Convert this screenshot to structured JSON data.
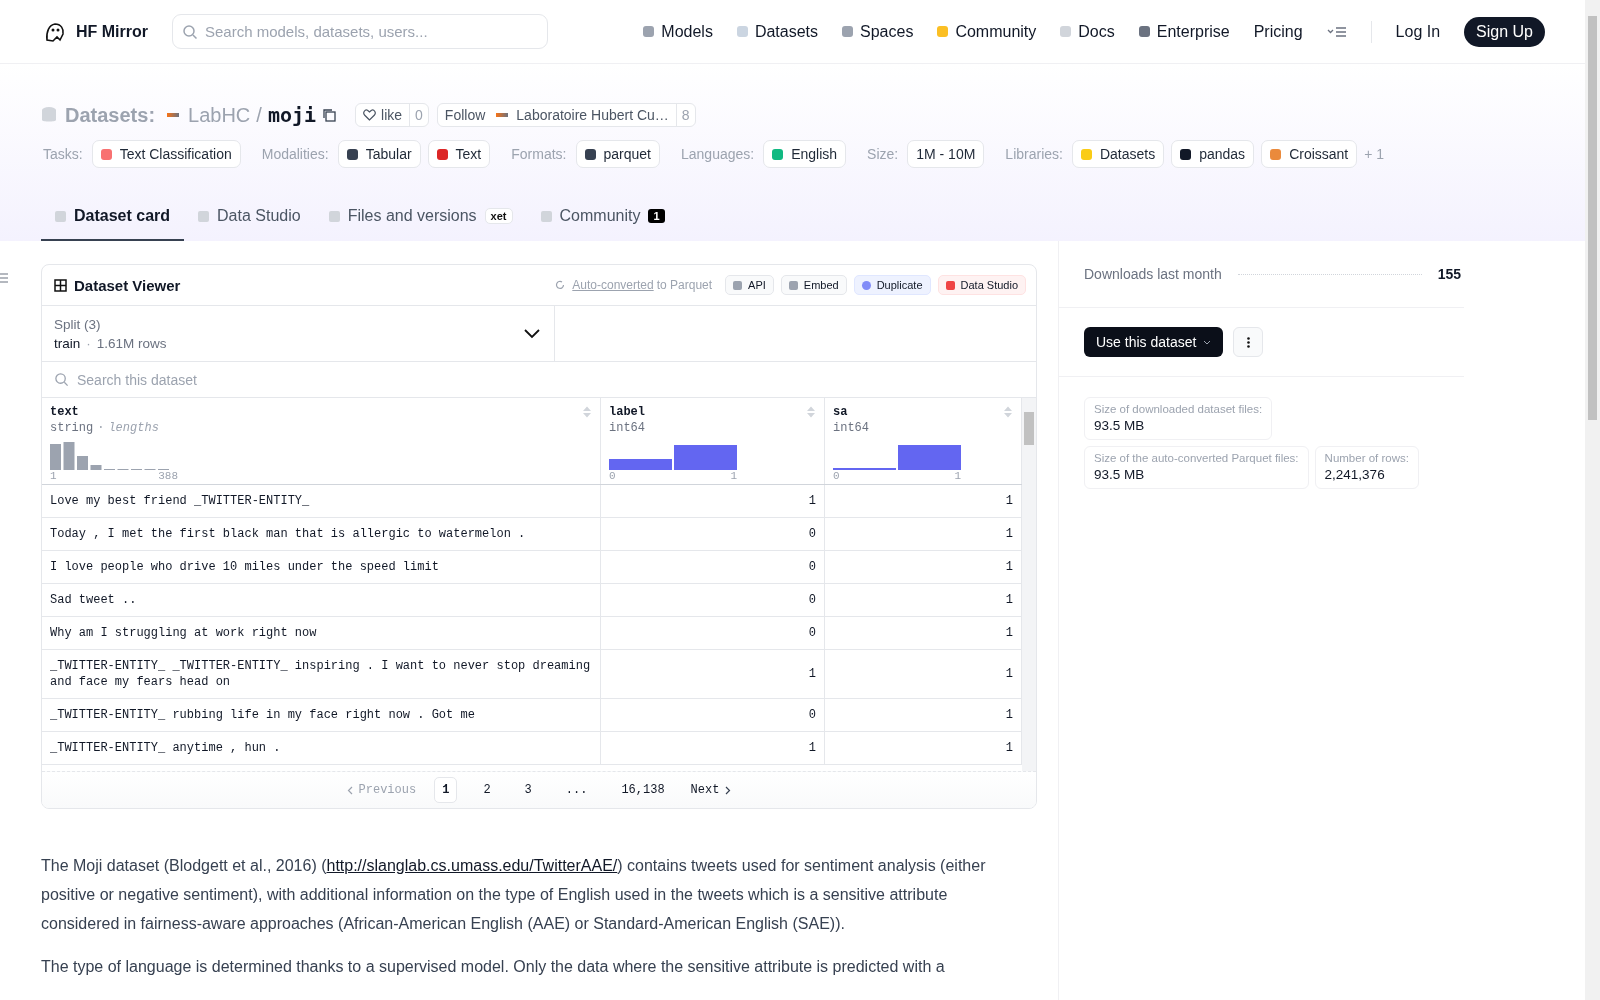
{
  "header": {
    "brand": "HF Mirror",
    "search": {
      "placeholder": "Search models, datasets, users..."
    },
    "nav": [
      "Models",
      "Datasets",
      "Spaces",
      "Community",
      "Docs",
      "Enterprise",
      "Pricing"
    ],
    "login": "Log In",
    "signup": "Sign Up"
  },
  "repo": {
    "section": "Datasets:",
    "owner": "LabHC",
    "separator": "/",
    "name": "moji",
    "like": {
      "label": "like",
      "count": "0"
    },
    "follow": {
      "label": "Follow",
      "org": "Laboratoire Hubert Cu…",
      "count": "8"
    }
  },
  "tag_groups": [
    {
      "label": "Tasks:",
      "tags": [
        "Text Classification"
      ]
    },
    {
      "label": "Modalities:",
      "tags": [
        "Tabular",
        "Text"
      ]
    },
    {
      "label": "Formats:",
      "tags": [
        "parquet"
      ]
    },
    {
      "label": "Languages:",
      "tags": [
        "English"
      ]
    },
    {
      "label": "Size:",
      "tags": [
        "1M - 10M"
      ]
    },
    {
      "label": "Libraries:",
      "tags": [
        "Datasets",
        "pandas",
        "Croissant"
      ],
      "more": "+ 1"
    }
  ],
  "tabs": [
    {
      "label": "Dataset card",
      "selected": true
    },
    {
      "label": "Data Studio",
      "selected": false
    },
    {
      "label": "Files and versions",
      "selected": false,
      "badge": "xet"
    },
    {
      "label": "Community",
      "selected": false,
      "count": "1"
    }
  ],
  "viewer": {
    "title": "Dataset Viewer",
    "converted": {
      "link": "Auto-converted",
      "text": "to Parquet"
    },
    "actions": [
      {
        "label": "API",
        "kind": "plain"
      },
      {
        "label": "Embed",
        "kind": "plain"
      },
      {
        "label": "Duplicate",
        "kind": "accent"
      },
      {
        "label": "Data Studio",
        "kind": "danger"
      }
    ],
    "split": {
      "label": "Split (3)",
      "value": "train",
      "separator": "·",
      "rows": "1.61M rows"
    },
    "search": {
      "placeholder": "Search this dataset"
    },
    "columns": [
      {
        "name": "text",
        "type": "string",
        "separator": "·",
        "note": "lengths",
        "kind": "lengths",
        "min": "1",
        "max": "388"
      },
      {
        "name": "label",
        "type": "int64",
        "kind": "classes",
        "min": "0",
        "max": "1"
      },
      {
        "name": "sa",
        "type": "int64",
        "kind": "classes",
        "min": "0",
        "max": "1"
      }
    ],
    "rows": [
      [
        "Love my best friend _TWITTER-ENTITY_",
        "1",
        "1"
      ],
      [
        "Today , I met the first black man that is allergic to watermelon .",
        "0",
        "1"
      ],
      [
        "I love people who drive 10 miles under the speed limit",
        "0",
        "1"
      ],
      [
        "Sad tweet ..",
        "0",
        "1"
      ],
      [
        "Why am I struggling at work right now",
        "0",
        "1"
      ],
      [
        "_TWITTER-ENTITY_ _TWITTER-ENTITY_ inspiring . I want to never stop dreaming and face my fears head on",
        "1",
        "1"
      ],
      [
        "_TWITTER-ENTITY_ rubbing life in my face right now . Got me",
        "0",
        "1"
      ],
      [
        "_TWITTER-ENTITY_ anytime , hun .",
        "1",
        "1"
      ]
    ],
    "pagination": {
      "previous": "Previous",
      "pages": [
        {
          "label": "1",
          "kind": "page",
          "selected": true
        },
        {
          "label": "2",
          "kind": "page",
          "selected": false
        },
        {
          "label": "3",
          "kind": "page",
          "selected": false
        },
        {
          "label": "...",
          "kind": "gap"
        },
        {
          "label": "16,138",
          "kind": "page",
          "selected": false
        }
      ],
      "next": "Next"
    }
  },
  "card": {
    "paragraphs": [
      {
        "before": "The Moji dataset (Blodgett et al., 2016) (",
        "link": "http://slanglab.cs.umass.edu/TwitterAAE/",
        "after": ") contains tweets used for sentiment analysis (either positive or negative sentiment), with additional information on the type of English used in the tweets which is a sensitive attribute considered in fairness-aware approaches (African-American English (AAE) or Standard-American English (SAE))."
      },
      {
        "before": "The type of language is determined thanks to a supervised model. Only the data where the sensitive attribute is predicted with a"
      }
    ]
  },
  "sidebar": {
    "downloads": {
      "label": "Downloads last month",
      "value": "155"
    },
    "use_button": "Use this dataset",
    "stats": [
      [
        {
          "label": "Size of downloaded dataset files:",
          "value": "93.5 MB"
        }
      ],
      [
        {
          "label": "Size of the auto-converted Parquet files:",
          "value": "93.5 MB"
        },
        {
          "label": "Number of rows:",
          "value": "2,241,376"
        }
      ]
    ]
  }
}
